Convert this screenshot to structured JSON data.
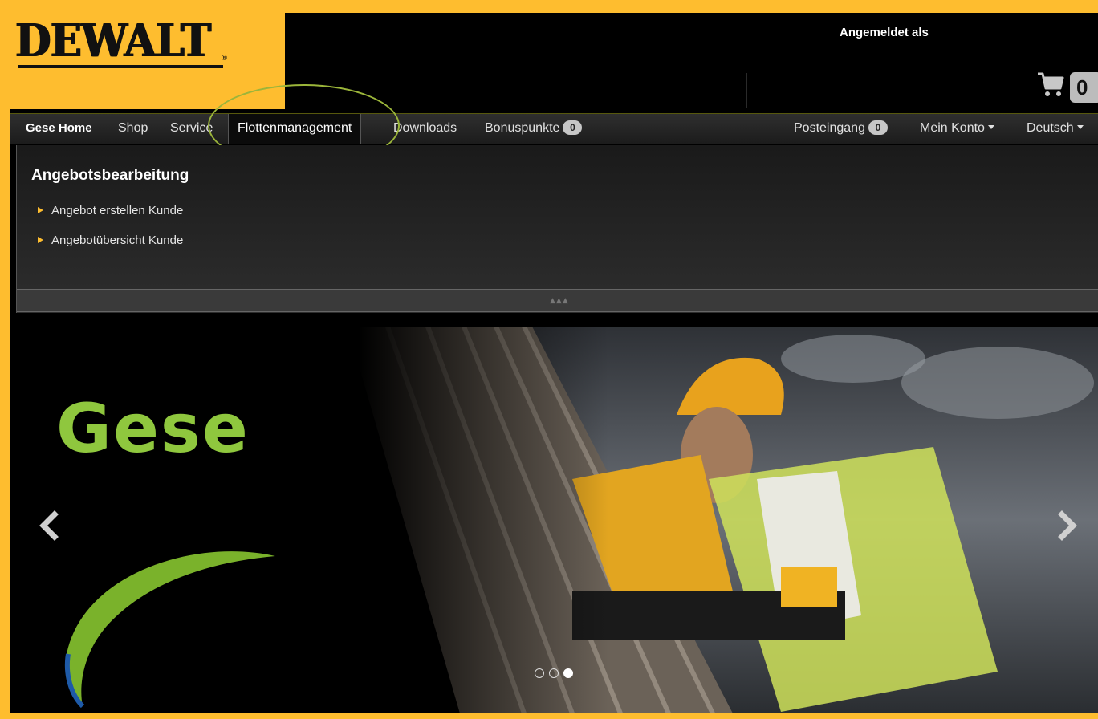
{
  "brand": {
    "logo_text": "DEWALT",
    "logo_mark": "®",
    "accent_color": "#febd2f"
  },
  "header": {
    "logged_in_label": "Angemeldet als",
    "cart_icon": "cart-icon",
    "cart_count": "0"
  },
  "nav": {
    "home": "Gese Home",
    "shop": "Shop",
    "service": "Service",
    "fleet": "Flottenmanagement",
    "downloads": "Downloads",
    "bonus": "Bonuspunkte",
    "bonus_count": "0",
    "inbox": "Posteingang",
    "inbox_count": "0",
    "account": "Mein Konto",
    "language": "Deutsch"
  },
  "dropdown": {
    "title": "Angebotsbearbeitung",
    "links": [
      {
        "label": "Angebot erstellen Kunde"
      },
      {
        "label": "Angebotübersicht Kunde"
      }
    ],
    "collapse_icon": "▲▲▲"
  },
  "hero": {
    "prev_icon": "chevron-left-icon",
    "next_icon": "chevron-right-icon",
    "slides_total": 3,
    "active_slide": 3,
    "partner_logo_text": "Gese"
  }
}
